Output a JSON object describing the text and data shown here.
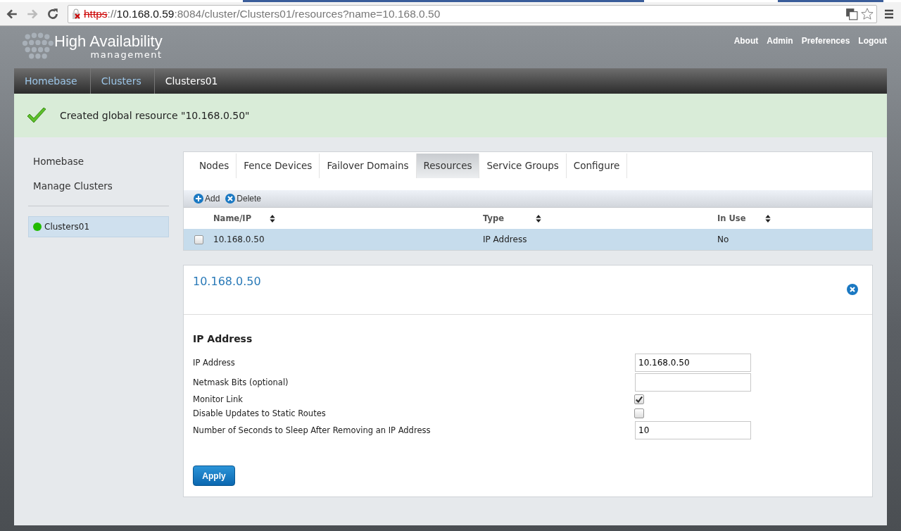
{
  "browser": {
    "url": {
      "scheme": "https",
      "separator": "://",
      "host": "10.168.0.59",
      "rest": ":8084/cluster/Clusters01/resources?name=10.168.0.50"
    }
  },
  "header": {
    "logo_title": "High Availability",
    "logo_subtitle": "management",
    "links": [
      "About",
      "Admin",
      "Preferences",
      "Logout"
    ]
  },
  "breadcrumb": [
    {
      "label": "Homebase",
      "selected": false
    },
    {
      "label": "Clusters",
      "selected": false
    },
    {
      "label": "Clusters01",
      "selected": true
    }
  ],
  "message": "Created global resource \"10.168.0.50\"",
  "sidebar": {
    "links": [
      "Homebase",
      "Manage Clusters"
    ],
    "clusters": [
      {
        "name": "Clusters01",
        "color": "#22bb00",
        "selected": true
      }
    ]
  },
  "tabs": [
    {
      "label": "Nodes",
      "selected": false
    },
    {
      "label": "Fence Devices",
      "selected": false
    },
    {
      "label": "Failover Domains",
      "selected": false
    },
    {
      "label": "Resources",
      "selected": true
    },
    {
      "label": "Service Groups",
      "selected": false
    },
    {
      "label": "Configure",
      "selected": false
    }
  ],
  "toolbar": [
    {
      "kind": "add",
      "label": "Add"
    },
    {
      "kind": "delete",
      "label": "Delete"
    }
  ],
  "table": {
    "columns": [
      "Name/IP",
      "Type",
      "In Use"
    ],
    "rows": [
      {
        "checked": false,
        "selected": true,
        "cells": [
          "10.168.0.50",
          "IP Address",
          "No"
        ]
      }
    ]
  },
  "detail": {
    "title": "10.168.0.50",
    "section": "IP Address",
    "fields": [
      {
        "kind": "text",
        "label": "IP Address",
        "value": "10.168.0.50"
      },
      {
        "kind": "text",
        "label": "Netmask Bits (optional)"
      },
      {
        "kind": "checkbox",
        "label": "Monitor Link",
        "checked": true
      },
      {
        "kind": "checkbox",
        "label": "Disable Updates to Static Routes",
        "checked": false
      },
      {
        "kind": "text",
        "label": "Number of Seconds to Sleep After Removing an IP Address",
        "value": "10"
      }
    ],
    "apply": "Apply"
  }
}
